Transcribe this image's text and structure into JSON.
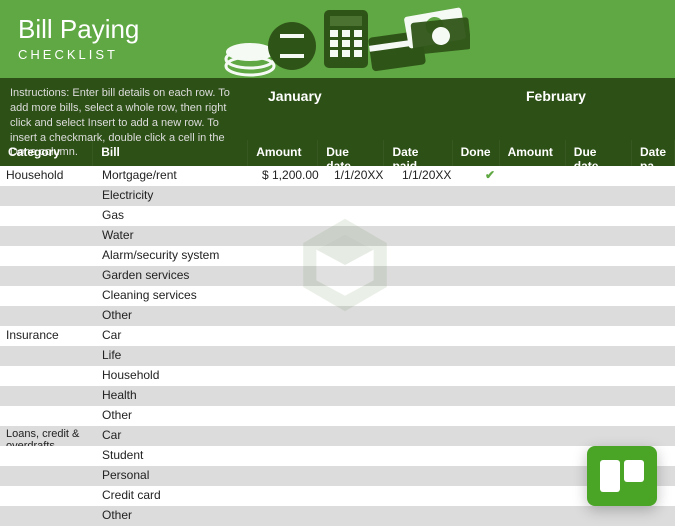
{
  "header": {
    "title": "Bill Paying",
    "subtitle": "CHECKLIST"
  },
  "instructions": "Instructions: Enter bill details on each row. To add more bills, select a whole row, then right click and select Insert to add a new row. To insert a checkmark, double click a cell in the Done column.",
  "months": {
    "jan": "January",
    "feb": "February"
  },
  "cols": {
    "category": "Category",
    "bill": "Bill",
    "amount": "Amount",
    "due": "Due date",
    "paid": "Date paid",
    "done": "Done",
    "amount2": "Amount",
    "due2": "Due date",
    "paid2": "Date pa"
  },
  "groups": [
    {
      "category": "Household",
      "rows": [
        {
          "bill": "Mortgage/rent",
          "amount": "$    1,200.00",
          "due": "1/1/20XX",
          "paid": "1/1/20XX",
          "done": "✔"
        },
        {
          "bill": "Electricity"
        },
        {
          "bill": "Gas"
        },
        {
          "bill": "Water"
        },
        {
          "bill": "Alarm/security system"
        },
        {
          "bill": "Garden services"
        },
        {
          "bill": "Cleaning services"
        },
        {
          "bill": "Other"
        }
      ]
    },
    {
      "category": "Insurance",
      "rows": [
        {
          "bill": "Car"
        },
        {
          "bill": "Life"
        },
        {
          "bill": "Household"
        },
        {
          "bill": "Health"
        },
        {
          "bill": "Other"
        }
      ]
    },
    {
      "category": "Loans, credit & overdrafts",
      "rows": [
        {
          "bill": "Car"
        },
        {
          "bill": "Student"
        },
        {
          "bill": "Personal"
        },
        {
          "bill": "Credit card"
        },
        {
          "bill": "Other"
        }
      ]
    }
  ]
}
